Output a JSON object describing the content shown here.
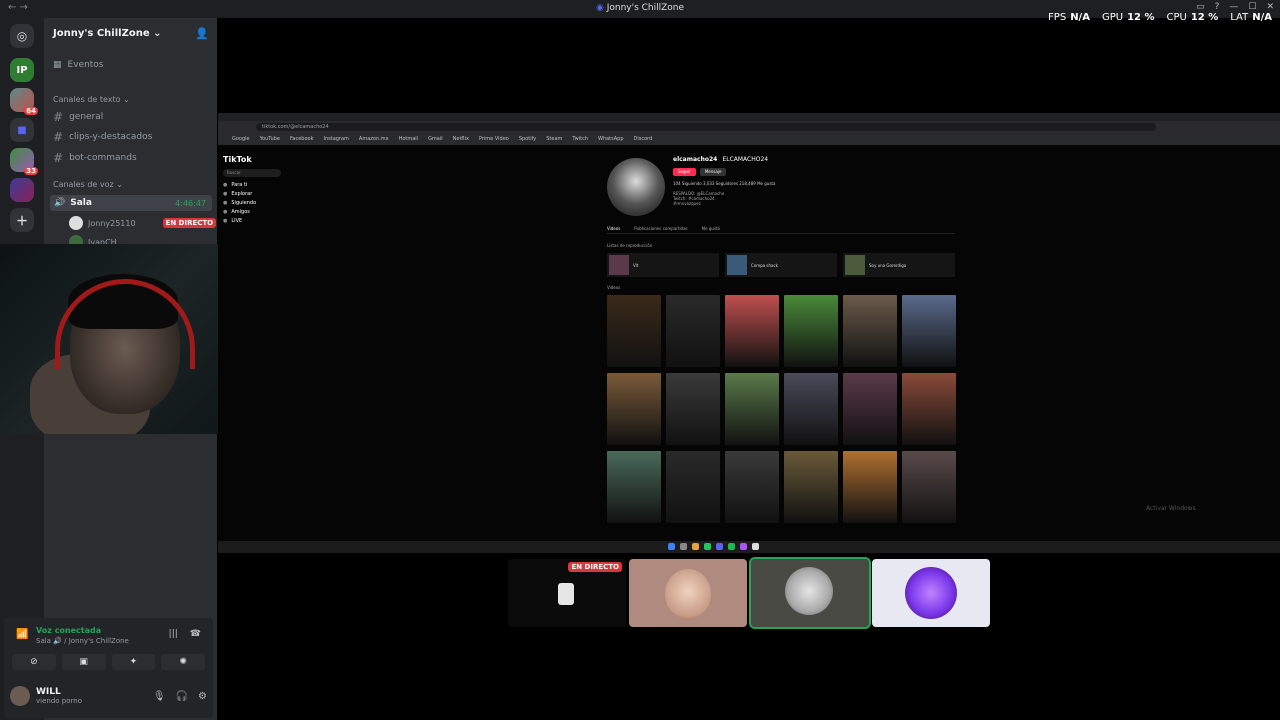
{
  "window": {
    "title": "Jonny's ChillZone",
    "nav": "← →",
    "buttons": [
      "▭",
      "?",
      "—",
      "☐",
      "✕"
    ]
  },
  "stats": {
    "fps_label": "FPS",
    "fps_value": "N/A",
    "gpu_label": "GPU",
    "gpu_value": "12 %",
    "cpu_label": "CPU",
    "cpu_value": "12 %",
    "lat_label": "LAT",
    "lat_value": "N/A"
  },
  "servers": {
    "badges": [
      "64",
      "33"
    ]
  },
  "sidebar": {
    "guild_name": "Jonny's ChillZone ⌄",
    "events_label": "Eventos",
    "text_category": "Canales de texto ⌄",
    "text_channels": [
      "general",
      "clips-y-destacados",
      "bot-commands"
    ],
    "voice_category": "Canales de voz ⌄",
    "voice_channel": "Sala",
    "voice_time": "4:46:47",
    "voice_users": [
      {
        "name": "Jonny25110",
        "badge": "EN DIRECTO"
      },
      {
        "name": "IvanCH",
        "badge": ""
      }
    ]
  },
  "panel": {
    "title": "Voz conectada",
    "subtitle": "Sala 🔊 / Jonny's ChillZone",
    "user_name": "WILL",
    "user_status": "viendo porno"
  },
  "stream": {
    "url": "tiktok.com/@elcamacho24",
    "bookmarks": [
      "Google",
      "YouTube",
      "Facebook",
      "Instagram",
      "Amazon.mx",
      "Hotmail",
      "Gmail",
      "Netflix",
      "Prime Video",
      "Spotify",
      "Steam",
      "Twitch",
      "WhatsApp",
      "Discord"
    ],
    "tiktok": {
      "logo": "TikTok",
      "search": "Buscar",
      "nav": [
        "Para ti",
        "Explorar",
        "Siguiendo",
        "Amigos",
        "LIVE"
      ],
      "username": "elcamacho24",
      "handle": "ELCAMACHO24",
      "follow": "Seguir",
      "message": "Mensaje",
      "stats": "104 Siguiendo   3,033 Seguidores   218,489 Me gusta",
      "bio": "RESPALDO: @ELCamacho\nTwitch: #camacho24\n#rmvvazquez",
      "tabs": [
        "Videos",
        "Publicaciones compartidas",
        "Me gustó"
      ],
      "playlists_label": "Listas de reproducción",
      "playlists": [
        "Vlt",
        "Compa shack",
        "Soy una Gorerdiga"
      ],
      "videos_label": "Videos"
    },
    "watermark": "Activar Windows"
  },
  "tiles": {
    "live_badge": "EN DIRECTO"
  }
}
